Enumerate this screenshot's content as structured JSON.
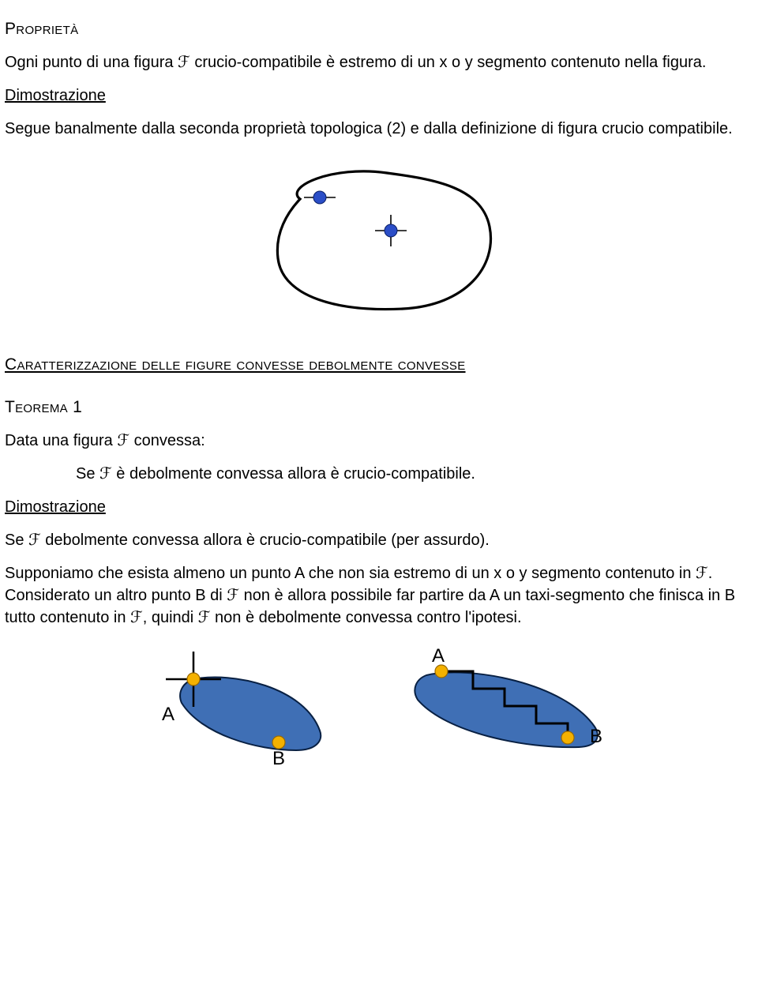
{
  "heading_proprieta": "Proprietà",
  "para_proprieta": "Ogni punto di una figura ℱ crucio-compatibile è estremo di un x o y segmento contenuto nella figura.",
  "dimostrazione_label": "Dimostrazione",
  "para_dimo1": "Segue banalmente dalla seconda proprietà topologica (2) e dalla definizione di figura crucio compatibile.",
  "heading_caratt": "Caratterizzazione delle figure convesse debolmente convesse",
  "heading_teorema": "Teorema 1",
  "para_data": "Data una figura ℱ convessa:",
  "para_se": "Se ℱ è debolmente convessa allora è crucio-compatibile.",
  "para_dimo2": "Se ℱ debolmente convessa allora è crucio-compatibile (per assurdo).",
  "para_supponiamo": "Supponiamo che esista almeno un punto A che non sia estremo di un x o y segmento contenuto in ℱ. Considerato un altro punto B di ℱ non è allora possibile far partire da A un taxi-segmento che finisca in B tutto contenuto in ℱ, quindi ℱ non è debolmente convessa contro l'ipotesi.",
  "label_A": "A",
  "label_B": "B"
}
